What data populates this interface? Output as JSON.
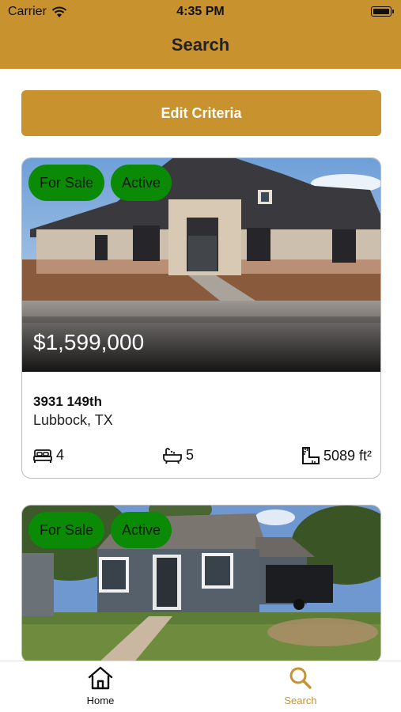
{
  "status_bar": {
    "carrier": "Carrier",
    "time": "4:35 PM"
  },
  "header": {
    "title": "Search"
  },
  "edit_criteria_label": "Edit Criteria",
  "listings": [
    {
      "badges": [
        "For Sale",
        "Active"
      ],
      "price": "$1,599,000",
      "address_line1": "3931 149th",
      "address_line2": "Lubbock, TX",
      "beds": "4",
      "baths": "5",
      "sqft": "5089 ft²"
    },
    {
      "badges": [
        "For Sale",
        "Active"
      ]
    }
  ],
  "tabs": [
    {
      "label": "Home",
      "icon": "house-icon",
      "active": false
    },
    {
      "label": "Search",
      "icon": "magnifier-icon",
      "active": true
    }
  ],
  "colors": {
    "brand": "#c8922e",
    "badge_green": "#0b8a06",
    "tab_active": "#c8922e",
    "tab_inactive": "#111111"
  }
}
